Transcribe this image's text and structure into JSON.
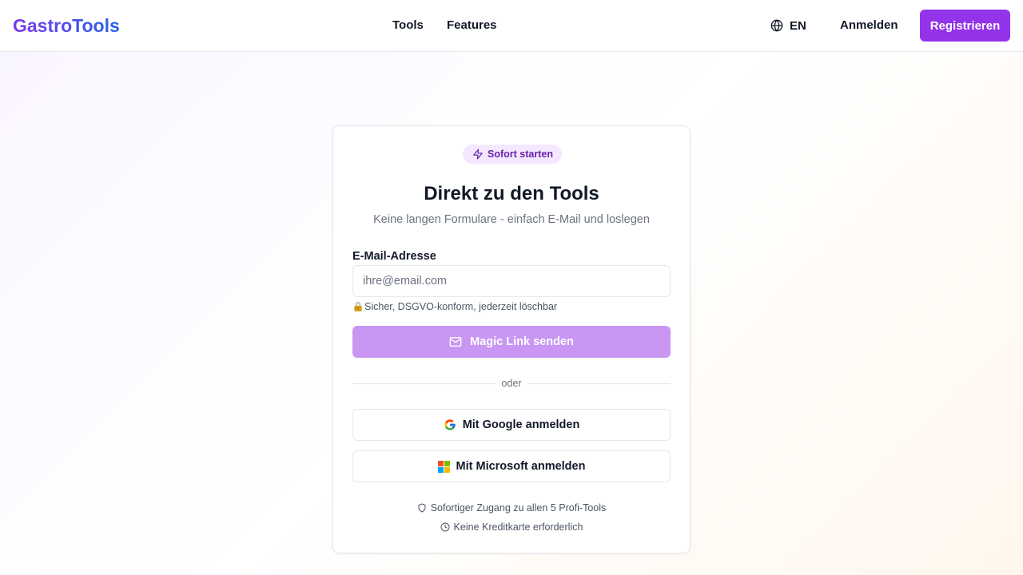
{
  "brand": {
    "name": "GastroTools"
  },
  "nav": {
    "links": [
      "Tools",
      "Features"
    ],
    "language": "EN",
    "login": "Anmelden",
    "register": "Registrieren"
  },
  "card": {
    "badge": "Sofort starten",
    "title": "Direkt zu den Tools",
    "subtitle": "Keine langen Formulare - einfach E-Mail und loslegen",
    "email_label": "E-Mail-Adresse",
    "email_placeholder": "ihre@email.com",
    "email_value": "",
    "privacy_hint": "Sicher, DSGVO-konform, jederzeit löschbar",
    "magic_link_button": "Magic Link senden",
    "divider_text": "oder",
    "google_button": "Mit Google anmelden",
    "microsoft_button": "Mit Microsoft anmelden",
    "features": [
      {
        "icon": "shield-icon",
        "text": "Sofortiger Zugang zu allen 5 Profi-Tools"
      },
      {
        "icon": "clock-icon",
        "text": "Keine Kreditkarte erforderlich"
      }
    ]
  },
  "colors": {
    "accent": "#9333ea",
    "accent_disabled": "#c997f3",
    "badge_bg": "#f3e8ff",
    "badge_text": "#6b21a8",
    "logo_gradient": [
      "#7c3aed",
      "#2563eb"
    ]
  }
}
